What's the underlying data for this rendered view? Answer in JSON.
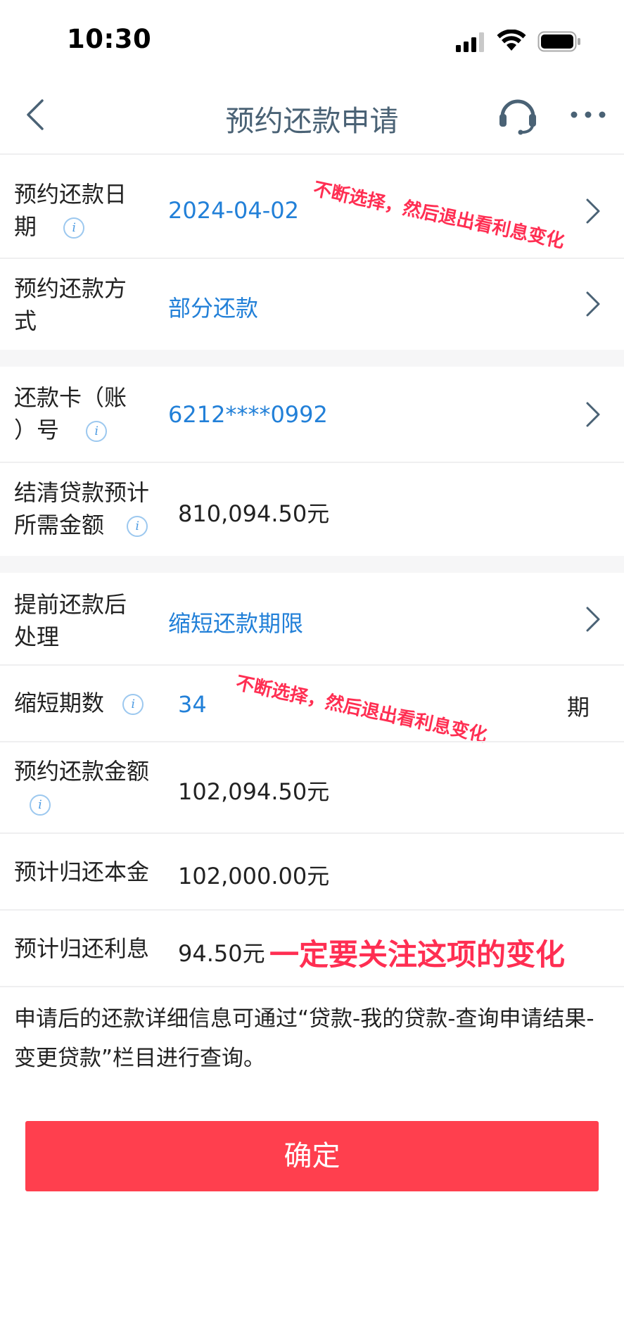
{
  "status_bar": {
    "time": "10:30"
  },
  "nav": {
    "title": "预约还款申请"
  },
  "rows": {
    "date": {
      "label_line1": "预约还款日",
      "label_line2": "期",
      "value": "2024-04-02"
    },
    "method": {
      "label_line1": "预约还款方",
      "label_line2": "式",
      "value": "部分还款"
    },
    "card": {
      "label_line1": "还款卡（账",
      "label_line2": "）号",
      "value": "6212****0992"
    },
    "settle": {
      "label_line1": "结清贷款预计",
      "label_line2": "所需金额",
      "value": "810,094.50元"
    },
    "after": {
      "label_line1": "提前还款后",
      "label_line2": "处理",
      "value": "缩短还款期限"
    },
    "periods": {
      "label": "缩短期数",
      "value": "34",
      "unit": "期"
    },
    "amount": {
      "label": "预约还款金额",
      "value": "102,094.50元"
    },
    "principal": {
      "label": "预计归还本金",
      "value": "102,000.00元"
    },
    "interest": {
      "label": "预计归还利息",
      "value": "94.50元"
    }
  },
  "info_glyph": "i",
  "annotations": {
    "top": "不断选择，然后退出看利息变化",
    "middle": "不断选择，然后退出看利息变化",
    "interest": "一定要关注这项的变化"
  },
  "note": "申请后的还款详细信息可通过“贷款-我的贷款-查询申请结果-变更贷款”栏目进行查询。",
  "confirm_button": "确定",
  "colors": {
    "accent_blue": "#2280d8",
    "button_red": "#ff3f4e",
    "annotation_red": "#ff2e52"
  },
  "icons": [
    "back-icon",
    "headset-icon",
    "more-icon",
    "signal-icon",
    "wifi-icon",
    "battery-icon",
    "info-icon",
    "chevron-right-icon"
  ]
}
